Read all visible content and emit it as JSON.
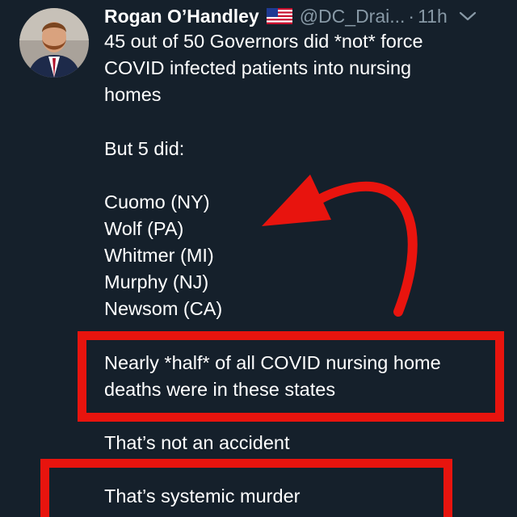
{
  "tweet": {
    "author_name": "Rogan O’Handley",
    "author_flag": "us-flag-icon",
    "handle": "@DC_Drai...",
    "separator": "·",
    "time": "11h",
    "menu_icon": "chevron-down-icon",
    "body_lines": [
      "45 out of 50 Governors did *not* force",
      "COVID infected patients into nursing",
      "homes",
      "But 5 did:",
      "Cuomo (NY)",
      "Wolf (PA)",
      "Whitmer (MI)",
      "Murphy (NJ)",
      "Newsom (CA)",
      "Nearly *half* of all COVID nursing home",
      "deaths were in these states",
      "That’s not an accident",
      "That’s systemic murder"
    ]
  },
  "colors": {
    "background": "#15202b",
    "text": "#ffffff",
    "muted": "#8899a6",
    "annotation_red": "#e8140e"
  }
}
